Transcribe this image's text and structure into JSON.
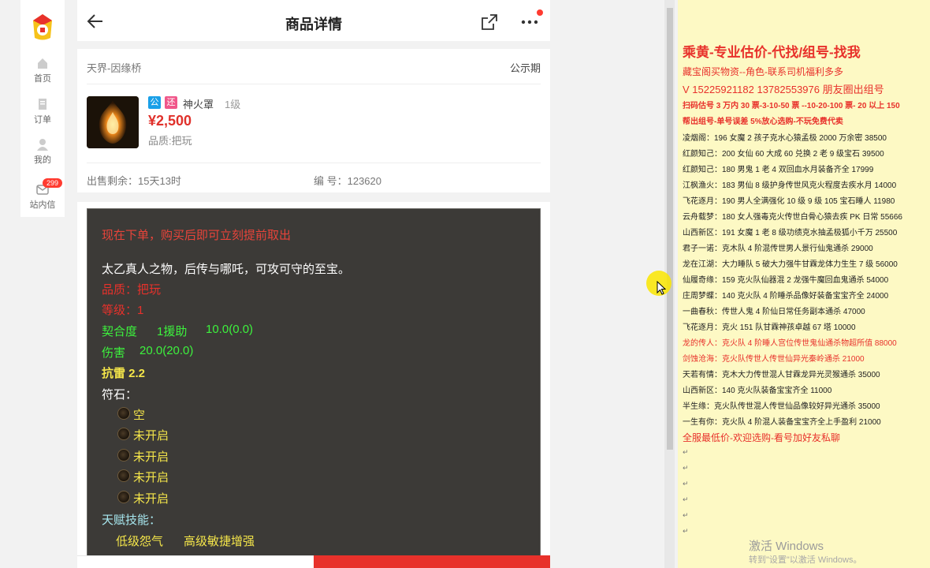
{
  "sidebar": {
    "items": [
      {
        "label": "首页"
      },
      {
        "label": "订单"
      },
      {
        "label": "我的"
      },
      {
        "label": "站内信",
        "badge": "299"
      }
    ]
  },
  "header": {
    "title": "商品详情"
  },
  "listing": {
    "server": "天界-因缘桥",
    "status": "公示期",
    "tag1": "公",
    "tag2": "还",
    "item_name": "神火罩",
    "level": "1级",
    "price": "¥2,500",
    "quality": "品质:把玩",
    "remaining": "出售剩余：15天13时",
    "code": "编 号：123620"
  },
  "description": {
    "notice": "现在下单，购买后即可立刻提前取出",
    "lore": "太乙真人之物，后传与哪吒，可攻可守的至宝。",
    "quality_line": "品质：把玩",
    "level_line": "等级：1",
    "fit_label": "契合度",
    "fit_assist": "1援助",
    "fit_value": "10.0(0.0)",
    "damage_label": "伤害",
    "damage_value": "20.0(20.0)",
    "resist": "抗雷 2.2",
    "rune_label": "符石：",
    "runes": [
      "空",
      "未开启",
      "未开启",
      "未开启",
      "未开启"
    ],
    "talent_label": "天赋技能：",
    "talent1": "低级怨气",
    "talent2": "高级敏捷增强"
  },
  "doc": {
    "heading": "乘黄-专业估价-代找/组号-找我",
    "contact1": "藏宝阁买物资--角色-联系司机福利多多",
    "contact2": "V 15225921182    13782553976 朋友圈出组号",
    "promo1": "扫码估号 3 万内 30 票-3-10-50 票 --10-20-100 票- 20 以上 150",
    "promo2": "帮出组号-单号误差 5%放心选购-不玩免费代卖",
    "lines": [
      "凌烟阁：196 女魔 2 孩子克水心猿孟极 2000 万余密 38500",
      "红颜知己：200 女仙 60 大成 60 兑换 2 老 9 级宝石 39500",
      "红颜知己：180 男鬼 1 老 4 双回血水月装备齐全 17999",
      "江枫渔火：183 男仙 8 级护身传世风克火程度去疾水月 14000",
      "飞花逐月：190 男人全满强化 10 级 9 级 105 宝石睡人 11980",
      "云舟载梦：180 女人强毒克火传世白骨心猿去疾 PK 日常 55666",
      "山西新区：191 女魔 1 老 8 级功绩克水抽孟极狐小千万 25500",
      "君子一诺：克木队 4 阶混传世男人景行仙鬼通杀 29000",
      "龙在江湖：大力睡队 5 破大力强牛甘霖龙体力生生 7 级 56000",
      "仙履奇缘：159 克火队仙器混 2 龙强牛魔回血鬼通杀 54000",
      "庄周梦蝶：140 克火队 4 阶睡杀品像好装备宝宝齐全 24000",
      "一曲春秋：传世人鬼 4 阶仙日常任务副本通杀 47000",
      "飞花逐月：克火 151 队甘霖神孩卓越 67 塔 10000"
    ],
    "red_lines": [
      "龙的传人：克火队 4 阶睡人宫位传世鬼仙通杀物超所值 88000",
      "剑蚀沧海：克火队传世人传世仙异光秦岭通杀 21000"
    ],
    "lines2": [
      "天若有情：克木大力传世混人甘霖龙异光灵猴通杀 35000",
      "山西新区：140 克火队装备宝宝齐全 11000",
      "半生缘：克火队传世混人传世仙品像较好异光通杀 35000",
      "一生有你：克火队 4 阶混人装备宝宝齐全上手盈利 21000"
    ],
    "footer": "全服最低价-欢迎选购-看号加好友私聊",
    "watermark_title": "激活 Windows",
    "watermark_sub": "转到\"设置\"以激活 Windows。"
  }
}
